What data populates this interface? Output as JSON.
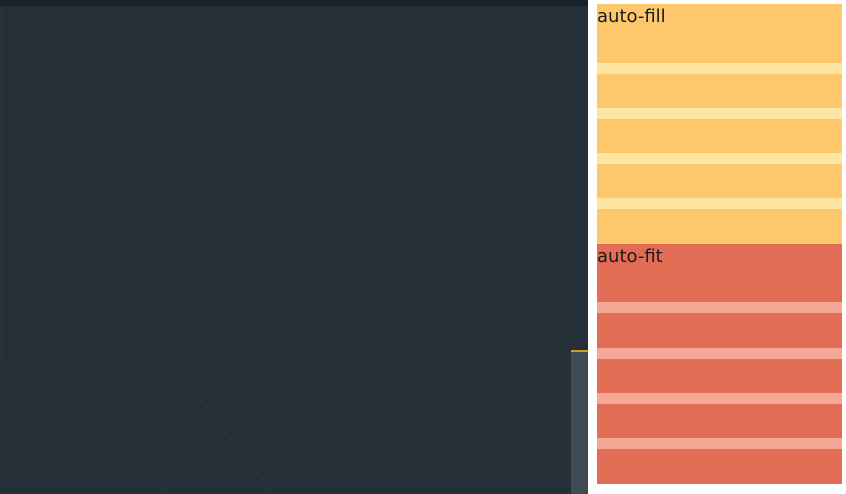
{
  "preview": {
    "auto_fill": {
      "label": "auto-fill",
      "color": "#fdc76c",
      "gap_color": "#fde6a2"
    },
    "auto_fit": {
      "label": "auto-fit",
      "color": "#e16d55",
      "gap_color": "#f5a896"
    }
  },
  "editor": {
    "background": "#242f37",
    "scroll_marker_color": "#c8a215"
  }
}
